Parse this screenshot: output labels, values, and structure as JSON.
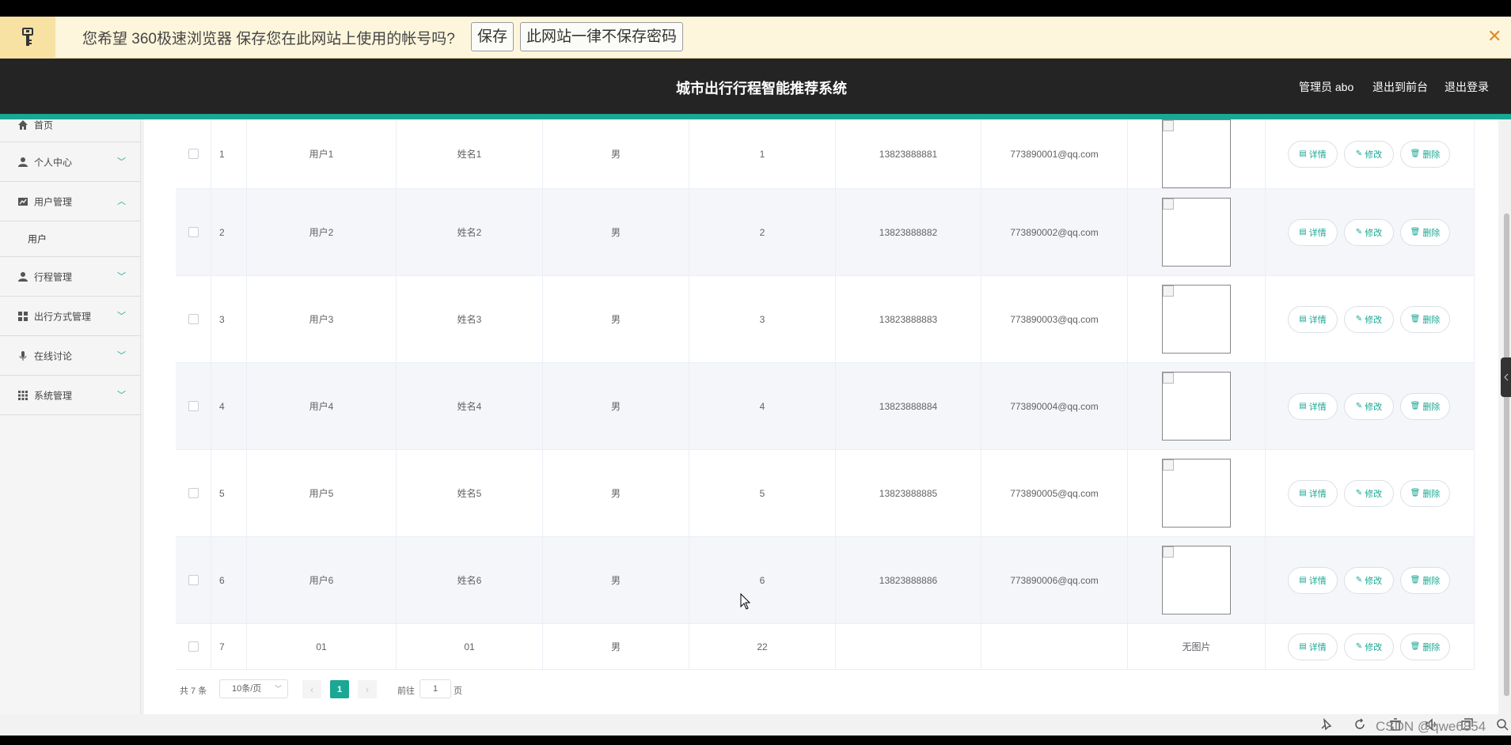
{
  "password_bar": {
    "message": "您希望 360极速浏览器 保存您在此网站上使用的帐号吗?",
    "save_label": "保存",
    "never_label": "此网站一律不保存密码",
    "close_glyph": "✕"
  },
  "header": {
    "title": "城市出行行程智能推荐系统",
    "admin_label": "管理员 abo",
    "to_frontend": "退出到前台",
    "logout": "退出登录"
  },
  "sidebar": {
    "items": [
      {
        "label": "首页",
        "icon": "home-icon",
        "has_chevron": false
      },
      {
        "label": "个人中心",
        "icon": "user-icon",
        "has_chevron": true,
        "chevron": "﹀"
      },
      {
        "label": "用户管理",
        "icon": "chart-icon",
        "has_chevron": true,
        "chevron": "︿"
      },
      {
        "label": "用户",
        "sub": true
      },
      {
        "label": "行程管理",
        "icon": "user-icon",
        "has_chevron": true,
        "chevron": "﹀"
      },
      {
        "label": "出行方式管理",
        "icon": "grid-icon",
        "has_chevron": true,
        "chevron": "﹀"
      },
      {
        "label": "在线讨论",
        "icon": "mic-icon",
        "has_chevron": true,
        "chevron": "﹀"
      },
      {
        "label": "系统管理",
        "icon": "apps-icon",
        "has_chevron": true,
        "chevron": "﹀"
      }
    ]
  },
  "table": {
    "rows": [
      {
        "index": "1",
        "account": "用户1",
        "name": "姓名1",
        "gender": "男",
        "age": "1",
        "phone": "13823888881",
        "email": "773890001@qq.com",
        "image": "placeholder"
      },
      {
        "index": "2",
        "account": "用户2",
        "name": "姓名2",
        "gender": "男",
        "age": "2",
        "phone": "13823888882",
        "email": "773890002@qq.com",
        "image": "placeholder"
      },
      {
        "index": "3",
        "account": "用户3",
        "name": "姓名3",
        "gender": "男",
        "age": "3",
        "phone": "13823888883",
        "email": "773890003@qq.com",
        "image": "placeholder"
      },
      {
        "index": "4",
        "account": "用户4",
        "name": "姓名4",
        "gender": "男",
        "age": "4",
        "phone": "13823888884",
        "email": "773890004@qq.com",
        "image": "placeholder"
      },
      {
        "index": "5",
        "account": "用户5",
        "name": "姓名5",
        "gender": "男",
        "age": "5",
        "phone": "13823888885",
        "email": "773890005@qq.com",
        "image": "placeholder"
      },
      {
        "index": "6",
        "account": "用户6",
        "name": "姓名6",
        "gender": "男",
        "age": "6",
        "phone": "13823888886",
        "email": "773890006@qq.com",
        "image": "placeholder"
      },
      {
        "index": "7",
        "account": "01",
        "name": "01",
        "gender": "男",
        "age": "22",
        "phone": "",
        "email": "",
        "image": "无图片"
      }
    ],
    "actions": {
      "detail": "详情",
      "edit": "修改",
      "delete": "删除"
    }
  },
  "pagination": {
    "total": "共 7 条",
    "page_size": "10条/页",
    "current_page": "1",
    "goto_label": "前往",
    "goto_value": "1",
    "page_unit": "页",
    "prev_glyph": "‹",
    "next_glyph": "›",
    "dropdown_glyph": "﹀"
  },
  "watermark": "CSDN @qwe6854",
  "colors": {
    "accent": "#1aa794",
    "header_bg": "#242424",
    "pwbar_bg": "#fdf6dc"
  }
}
